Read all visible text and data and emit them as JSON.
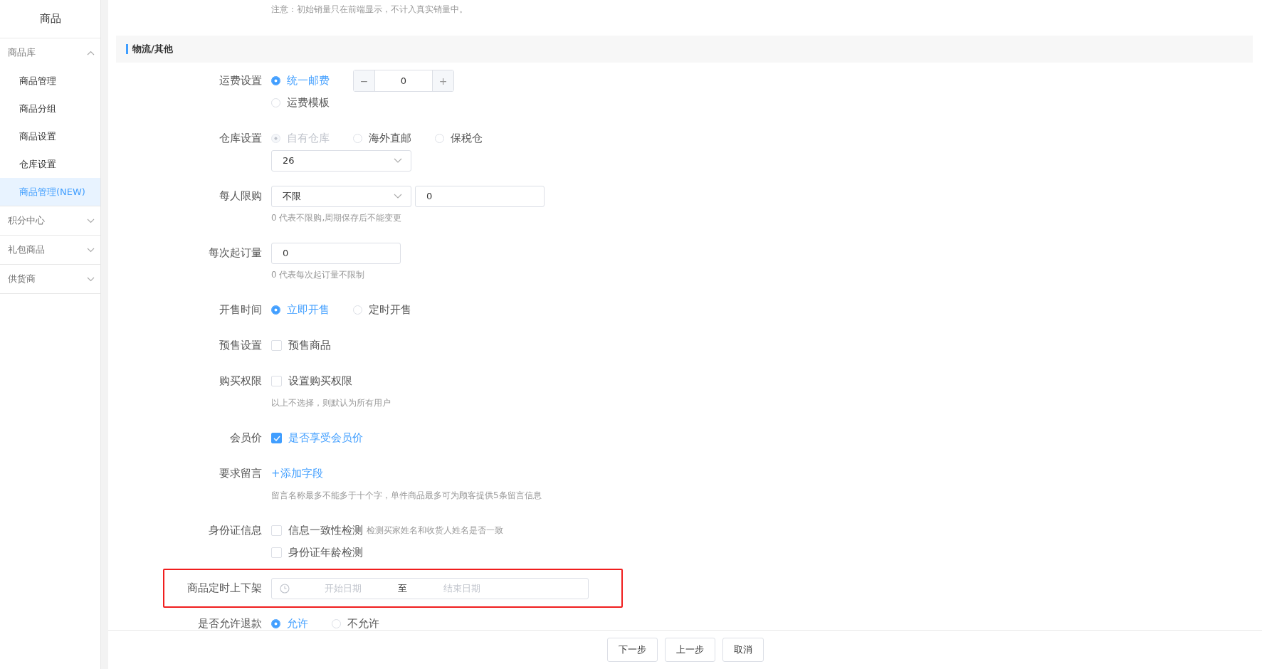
{
  "sidebar": {
    "title": "商品",
    "groups": [
      {
        "label": "商品库",
        "expanded": true,
        "items": [
          {
            "label": "商品管理",
            "selected": false
          },
          {
            "label": "商品分组",
            "selected": false
          },
          {
            "label": "商品设置",
            "selected": false
          },
          {
            "label": "仓库设置",
            "selected": false
          },
          {
            "label": "商品管理(NEW)",
            "selected": true
          }
        ]
      },
      {
        "label": "积分中心",
        "expanded": false
      },
      {
        "label": "礼包商品",
        "expanded": false
      },
      {
        "label": "供货商",
        "expanded": false
      }
    ]
  },
  "note": "注意：初始销量只在前端显示，不计入真实销量中。",
  "section": {
    "title": "物流/其他"
  },
  "fields": [
    {
      "label": "运费设置",
      "lines": [
        [
          {
            "kind": "radio",
            "label": "统一邮费",
            "selected": true,
            "disabled": false
          },
          {
            "kind": "stepper",
            "minus": "−",
            "value": "0",
            "plus": "+"
          }
        ],
        [
          {
            "kind": "radio",
            "label": "运费模板",
            "selected": false,
            "disabled": false
          }
        ]
      ]
    },
    {
      "label": "仓库设置",
      "lines": [
        [
          {
            "kind": "radio",
            "label": "自有仓库",
            "selected": true,
            "disabled": true
          },
          {
            "kind": "radio",
            "label": "海外直邮",
            "selected": false,
            "disabled": false
          },
          {
            "kind": "radio",
            "label": "保税仓",
            "selected": false,
            "disabled": false
          }
        ],
        [
          {
            "kind": "select",
            "value": "26"
          }
        ]
      ]
    },
    {
      "label": "每人限购",
      "lines": [
        [
          {
            "kind": "select",
            "value": "不限"
          },
          {
            "kind": "input",
            "value": "0"
          }
        ]
      ],
      "hint": "0 代表不限购,周期保存后不能变更"
    },
    {
      "label": "每次起订量",
      "lines": [
        [
          {
            "kind": "input",
            "value": "0"
          }
        ]
      ],
      "hint": "0 代表每次起订量不限制"
    },
    {
      "label": "开售时间",
      "lines": [
        [
          {
            "kind": "radio",
            "label": "立即开售",
            "selected": true,
            "disabled": false
          },
          {
            "kind": "radio",
            "label": "定时开售",
            "selected": false,
            "disabled": false
          }
        ]
      ]
    },
    {
      "label": "预售设置",
      "lines": [
        [
          {
            "kind": "checkbox",
            "label": "预售商品",
            "checked": false
          }
        ]
      ]
    },
    {
      "label": "购买权限",
      "lines": [
        [
          {
            "kind": "checkbox",
            "label": "设置购买权限",
            "checked": false
          }
        ]
      ],
      "hint": "以上不选择，则默认为所有用户"
    },
    {
      "label": "会员价",
      "lines": [
        [
          {
            "kind": "checkbox",
            "label": "是否享受会员价",
            "checked": true
          }
        ]
      ]
    },
    {
      "label": "要求留言",
      "lines": [
        [
          {
            "kind": "link",
            "text": "+添加字段"
          }
        ]
      ],
      "hint": "留言名称最多不能多于十个字，单件商品最多可为顾客提供5条留言信息"
    },
    {
      "label": "身份证信息",
      "lines": [
        [
          {
            "kind": "checkbox",
            "label": "信息一致性检测",
            "checked": false,
            "note": "检测买家姓名和收货人姓名是否一致"
          }
        ],
        [
          {
            "kind": "checkbox",
            "label": "身份证年龄检测",
            "checked": false
          }
        ]
      ]
    },
    {
      "label": "商品定时上下架",
      "highlighted": true,
      "lines": [
        [
          {
            "kind": "daterange",
            "start_placeholder": "开始日期",
            "separator": "至",
            "end_placeholder": "结束日期"
          }
        ]
      ]
    },
    {
      "label": "是否允许退款",
      "lines": [
        [
          {
            "kind": "radio",
            "label": "允许",
            "selected": true,
            "disabled": false
          },
          {
            "kind": "radio",
            "label": "不允许",
            "selected": false,
            "disabled": false
          }
        ]
      ]
    }
  ],
  "footer": {
    "buttons": [
      "下一步",
      "上一步",
      "取消"
    ]
  }
}
